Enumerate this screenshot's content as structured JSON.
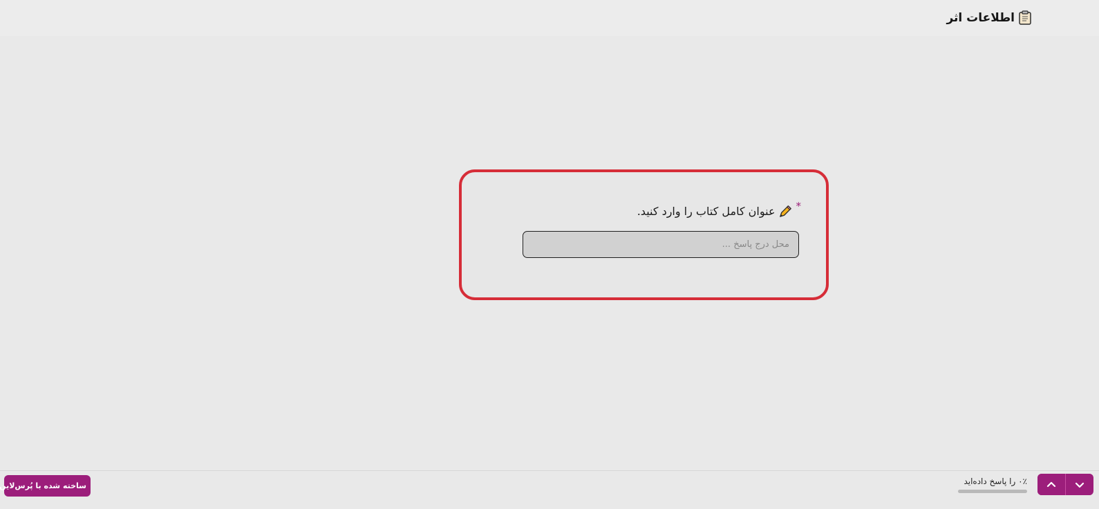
{
  "header": {
    "title": "اطلاعات اثر",
    "icon": "clipboard-icon"
  },
  "question": {
    "required_mark": "*",
    "icon": "pencil-icon",
    "label": "عنوان کامل کتاب را وارد کنید.",
    "input_value": "",
    "input_placeholder": "محل درج پاسخ ..."
  },
  "footer": {
    "brand_label": "ساخته شده با پُرس‌لاین",
    "progress_text": "۰٪ را پاسخ داده‌اید",
    "progress_fraction": 0,
    "up_icon": "chevron-up-icon",
    "down_icon": "chevron-down-icon"
  },
  "colors": {
    "background": "#e9e9e9",
    "card_border": "#d62d38",
    "brand": "#9c1e7b",
    "input_background": "#d1d1d1",
    "pencil_body": "#f5b21d"
  }
}
